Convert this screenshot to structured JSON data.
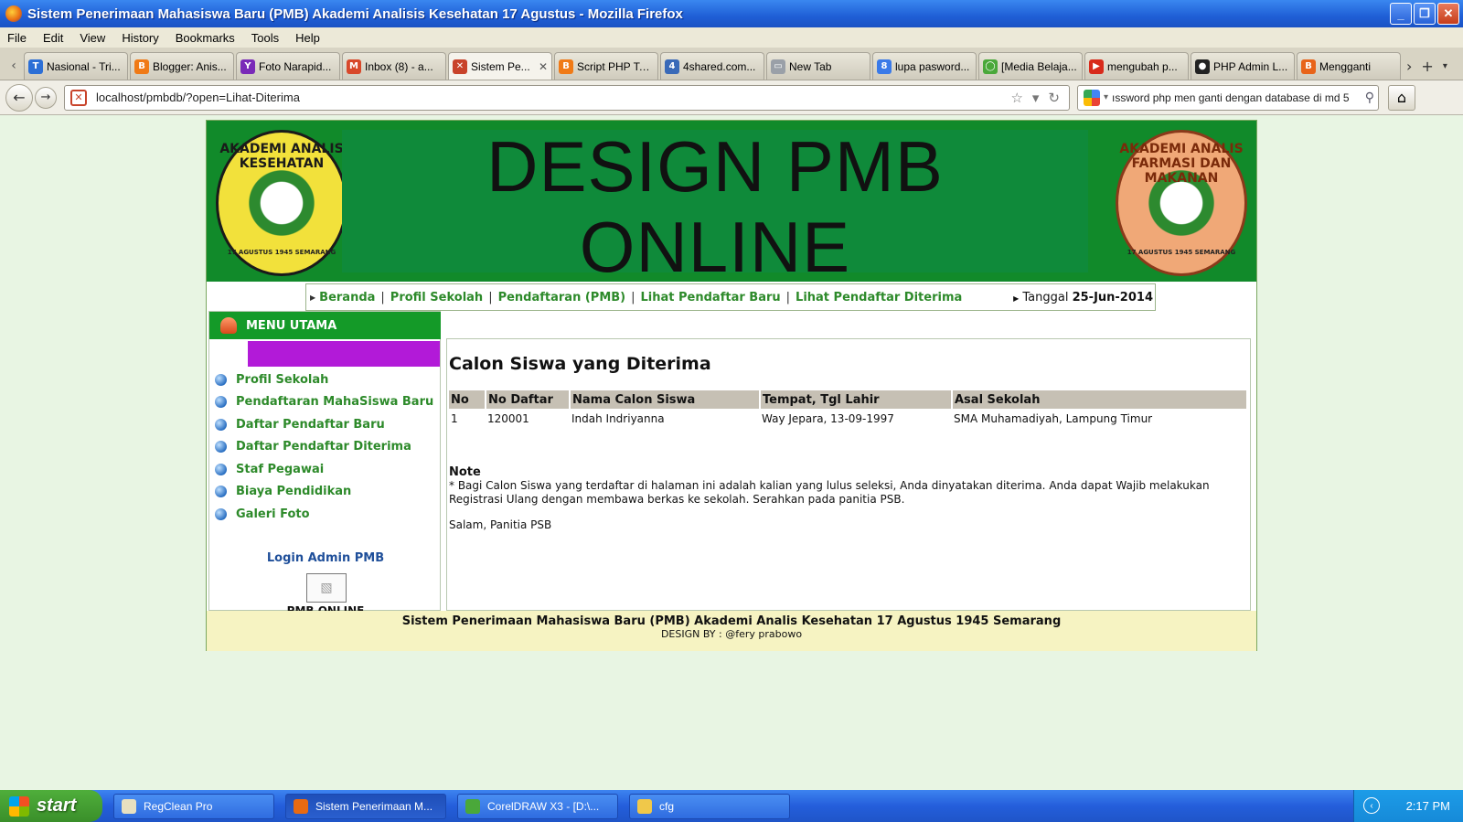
{
  "window": {
    "title": "Sistem Penerimaan Mahasiswa Baru (PMB) Akademi Analisis Kesehatan 17 Agustus - Mozilla Firefox",
    "buttons": {
      "minimize": "_",
      "maximize": "❐",
      "close": "✕"
    }
  },
  "menubar": [
    "File",
    "Edit",
    "View",
    "History",
    "Bookmarks",
    "Tools",
    "Help"
  ],
  "tabs": [
    {
      "label": "Nasional - Tri...",
      "color": "#2c6fd6",
      "glyph": "T"
    },
    {
      "label": "Blogger: Anis...",
      "color": "#f07a16",
      "glyph": "B"
    },
    {
      "label": "Foto Narapid...",
      "color": "#7a2ab8",
      "glyph": "Y"
    },
    {
      "label": "Inbox (8) - a...",
      "color": "#d8482a",
      "glyph": "M"
    },
    {
      "label": "Sistem Pe...",
      "color": "#c8432a",
      "glyph": "✕",
      "active": true
    },
    {
      "label": "Script PHP To...",
      "color": "#f07a16",
      "glyph": "B"
    },
    {
      "label": "4shared.com...",
      "color": "#3a6ab8",
      "glyph": "4"
    },
    {
      "label": "New Tab",
      "color": "#9aa0a8",
      "glyph": "▭"
    },
    {
      "label": "lupa pasword...",
      "color": "#3a7ae8",
      "glyph": "8"
    },
    {
      "label": "[Media Belaja...",
      "color": "#4aa83a",
      "glyph": "◯"
    },
    {
      "label": "mengubah p...",
      "color": "#d82a1a",
      "glyph": "▶"
    },
    {
      "label": "PHP Admin L...",
      "color": "#222222",
      "glyph": "●"
    },
    {
      "label": "Mengganti",
      "color": "#e8641a",
      "glyph": "B"
    }
  ],
  "nav": {
    "url": "localhost/pmbdb/?open=Lihat-Diterima",
    "search": "ıssword php men ganti dengan database di md 5"
  },
  "site": {
    "header_title_line1": "DESIGN PMB",
    "header_title_line2": "ONLINE",
    "logo_left_ring": "AKADEMI ANALIS KESEHATAN",
    "logo_left_small": "17 AGUSTUS 1945 SEMARANG",
    "logo_right_ring": "AKADEMI ANALIS FARMASI DAN MAKANAN",
    "logo_right_small": "17 AGUSTUS 1945 SEMARANG",
    "topnav": [
      "Beranda",
      "Profil Sekolah",
      "Pendaftaran (PMB)",
      "Lihat Pendaftar Baru",
      "Lihat Pendaftar Diterima"
    ],
    "date_label": "Tanggal",
    "date_value": "25-Jun-2014",
    "menu_title": "MENU UTAMA",
    "side_menu": [
      "Profil Sekolah",
      "Pendaftaran MahaSiswa Baru",
      "Daftar Pendaftar Baru",
      "Daftar Pendaftar Diterima",
      "Staf Pegawai",
      "Biaya Pendidikan",
      "Galeri Foto"
    ],
    "login_link": "Login Admin PMB",
    "pmb_online": "PMB ONLINE",
    "main_title": "Calon Siswa yang Diterima",
    "table": {
      "headers": [
        "No",
        "No Daftar",
        "Nama Calon Siswa",
        "Tempat, Tgl Lahir",
        "Asal Sekolah"
      ],
      "rows": [
        [
          "1",
          "120001",
          "Indah Indriyanna",
          "Way Jepara, 13-09-1997",
          "SMA Muhamadiyah, Lampung Timur"
        ]
      ]
    },
    "note_title": "Note",
    "note_text": "* Bagi Calon Siswa yang terdaftar di halaman ini adalah kalian yang lulus seleksi, Anda dinyatakan diterima. Anda dapat Wajib melakukan Registrasi Ulang dengan membawa berkas ke sekolah. Serahkan pada panitia PSB.",
    "salam": "Salam, Panitia PSB",
    "footer_line1": "Sistem Penerimaan Mahasiswa Baru (PMB) Akademi Analis Kesehatan 17 Agustus 1945 Semarang",
    "footer_line2": "DESIGN BY : @fery prabowo"
  },
  "taskbar": {
    "start": "start",
    "items": [
      {
        "label": "RegClean Pro",
        "color": "#e8e0c0"
      },
      {
        "label": "Sistem Penerimaan M...",
        "color": "#e86a12",
        "active": true
      },
      {
        "label": "CorelDRAW X3 - [D:\\...",
        "color": "#4aa83a"
      },
      {
        "label": "cfg",
        "color": "#f0c84a"
      }
    ],
    "clock": "2:17 PM"
  }
}
